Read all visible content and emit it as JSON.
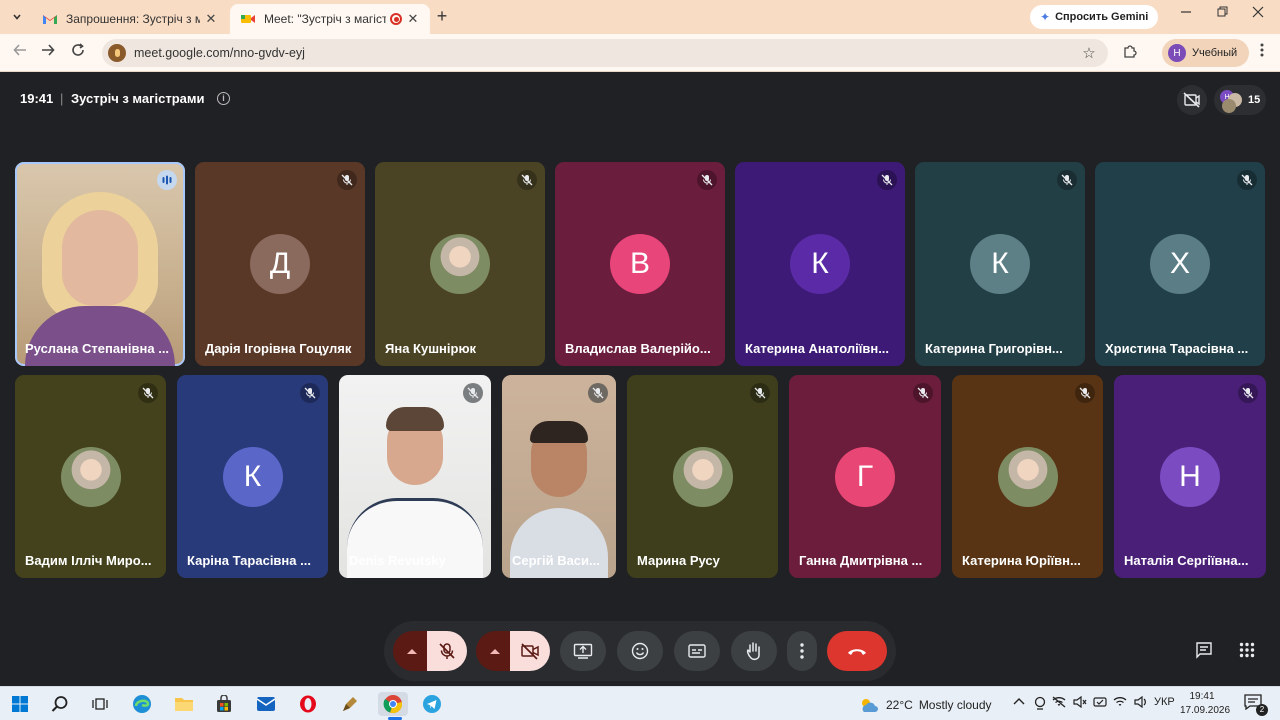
{
  "browser": {
    "tabs": [
      {
        "title": "Запрошення: Зустріч з магістрами",
        "close": "✕"
      },
      {
        "title": "Meet: \"Зустріч з магістрами\"",
        "close": "✕"
      }
    ],
    "new_tab": "+",
    "gemini_label": "Спросить Gemini",
    "url": "meet.google.com/nno-gvdv-eyj",
    "profile_initial": "Н",
    "profile_label": "Учебный"
  },
  "meeting": {
    "time": "19:41",
    "separator": "|",
    "title": "Зустріч з магістрами",
    "participant_count": "15",
    "people_initial": "Н"
  },
  "participants": [
    {
      "name": "Руслана Степанівна ...",
      "type": "video",
      "speaking": true
    },
    {
      "name": "Дарія Ігорівна Гоцуляк",
      "initial": "Д",
      "bg": "#5a3827",
      "av": "#8a6a5c"
    },
    {
      "name": "Яна Кушнірюк",
      "initial": "",
      "bg": "#4b4424",
      "av": "photo"
    },
    {
      "name": "Владислав Валерійо...",
      "initial": "В",
      "bg": "#6b1d3e",
      "av": "#e8457a"
    },
    {
      "name": "Катерина Анатоліївн...",
      "initial": "К",
      "bg": "#3c1a75",
      "av": "#5b2aa6"
    },
    {
      "name": "Катерина Григорівн...",
      "initial": "К",
      "bg": "#233f46",
      "av": "#5d7f86"
    },
    {
      "name": "Христина Тарасівна ...",
      "initial": "Х",
      "bg": "#213f48",
      "av": "#5b7d85"
    },
    {
      "name": "Вадим Ілліч Миро...",
      "initial": "",
      "bg": "#43421c",
      "av": "photo"
    },
    {
      "name": "Каріна Тарасівна ...",
      "initial": "К",
      "bg": "#293a7a",
      "av": "#5a66c8"
    },
    {
      "name": "Denis Revutsky",
      "type": "video2"
    },
    {
      "name": "Сергій Васи...",
      "type": "video3"
    },
    {
      "name": "Марина Русу",
      "initial": "",
      "bg": "#3e3e1c",
      "av": "photo"
    },
    {
      "name": "Ганна Дмитрівна ...",
      "initial": "Г",
      "bg": "#6b1d3b",
      "av": "#e84776"
    },
    {
      "name": "Катерина Юріївн...",
      "initial": "",
      "bg": "#583414",
      "av": "photo"
    },
    {
      "name": "Наталія Сергіївна...",
      "initial": "Н",
      "bg": "#4a1f78",
      "av": "#7b4bc2"
    }
  ],
  "taskbar": {
    "weather_temp": "22°C",
    "weather_text": "Mostly cloudy",
    "language": "УКР",
    "time": "19:41",
    "date": "17.09.2026",
    "notification_count": "2"
  },
  "colors": {
    "meet_bg": "#202124",
    "end_call": "#dc362e",
    "muted_active": "#f9dedc",
    "speaker_outline": "#a8c7fa",
    "chrome_tabstrip": "#f9dcc4"
  }
}
